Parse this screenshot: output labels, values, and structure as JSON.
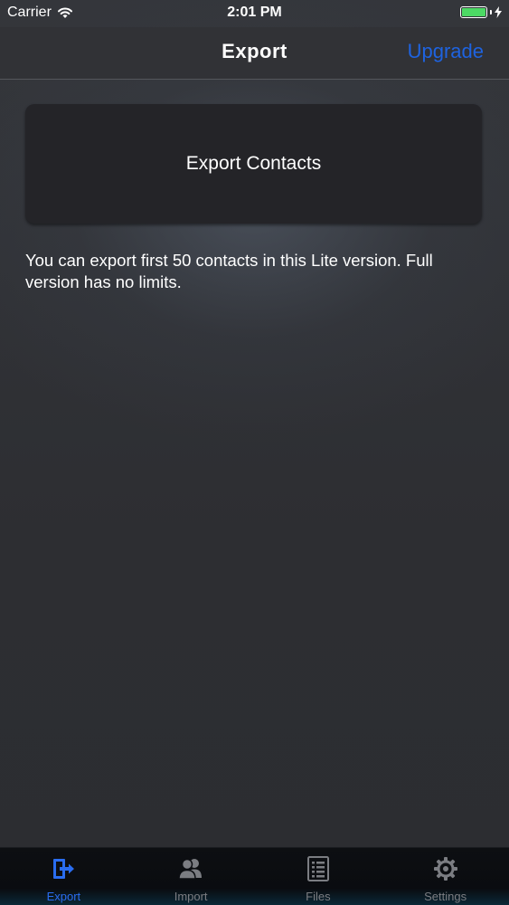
{
  "status_bar": {
    "carrier": "Carrier",
    "time": "2:01 PM",
    "battery_level": 1.0,
    "battery_color": "#4cd964"
  },
  "nav": {
    "title": "Export",
    "upgrade_label": "Upgrade",
    "accent_color": "#1e63e0"
  },
  "main": {
    "export_button_label": "Export Contacts",
    "notice_text": "You can export first 50 contacts in this Lite version. Full version has no limits."
  },
  "tabs": [
    {
      "label": "Export",
      "icon": "export-icon",
      "active": true
    },
    {
      "label": "Import",
      "icon": "contacts-icon",
      "active": false
    },
    {
      "label": "Files",
      "icon": "list-icon",
      "active": false
    },
    {
      "label": "Settings",
      "icon": "gear-icon",
      "active": false
    }
  ]
}
